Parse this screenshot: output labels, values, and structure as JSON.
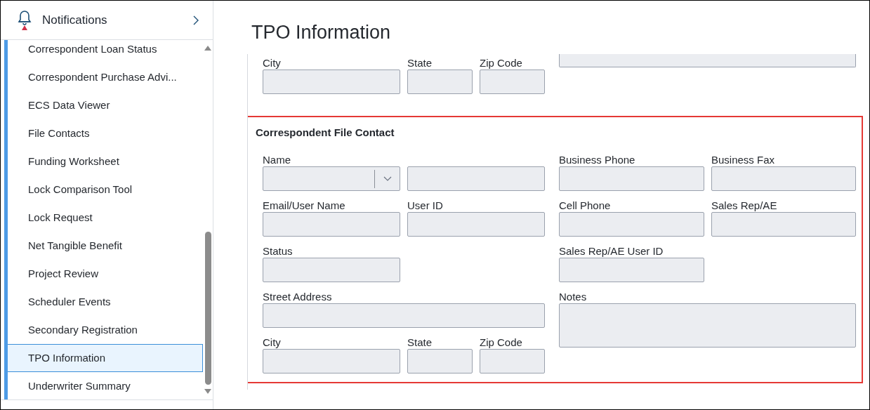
{
  "sidebar": {
    "header": {
      "title": "Notifications",
      "alert": true
    },
    "items": [
      {
        "label": "Correspondent Loan Status",
        "selected": false
      },
      {
        "label": "Correspondent Purchase Advi...",
        "selected": false
      },
      {
        "label": "ECS Data Viewer",
        "selected": false
      },
      {
        "label": "File Contacts",
        "selected": false
      },
      {
        "label": "Funding Worksheet",
        "selected": false
      },
      {
        "label": "Lock Comparison Tool",
        "selected": false
      },
      {
        "label": "Lock Request",
        "selected": false
      },
      {
        "label": "Net Tangible Benefit",
        "selected": false
      },
      {
        "label": "Project Review",
        "selected": false
      },
      {
        "label": "Scheduler Events",
        "selected": false
      },
      {
        "label": "Secondary Registration",
        "selected": false
      },
      {
        "label": "TPO Information",
        "selected": true
      },
      {
        "label": "Underwriter Summary",
        "selected": false
      }
    ]
  },
  "page_title": "TPO Information",
  "previous_section": {
    "fields": [
      {
        "kind": "textarea"
      },
      {
        "label": "City",
        "kind": "text"
      },
      {
        "label": "State",
        "kind": "text"
      },
      {
        "label": "Zip Code",
        "kind": "text"
      }
    ]
  },
  "section": {
    "title": "Correspondent File Contact",
    "highlighted": true,
    "fields": [
      {
        "label": "Name",
        "kind": "dropdown"
      },
      {
        "kind": "text"
      },
      {
        "label": "Business Phone",
        "kind": "text"
      },
      {
        "label": "Business Fax",
        "kind": "text"
      },
      {
        "label": "Email/User Name",
        "kind": "text"
      },
      {
        "label": "User ID",
        "kind": "text"
      },
      {
        "label": "Cell Phone",
        "kind": "text"
      },
      {
        "label": "Sales Rep/AE",
        "kind": "text"
      },
      {
        "label": "Status",
        "kind": "text"
      },
      {
        "label": "Sales Rep/AE User ID",
        "kind": "text"
      },
      {
        "label": "Street Address",
        "kind": "text"
      },
      {
        "label": "Notes",
        "kind": "textarea"
      },
      {
        "label": "City",
        "kind": "text"
      },
      {
        "label": "State",
        "kind": "text"
      },
      {
        "label": "Zip Code",
        "kind": "text"
      }
    ]
  }
}
